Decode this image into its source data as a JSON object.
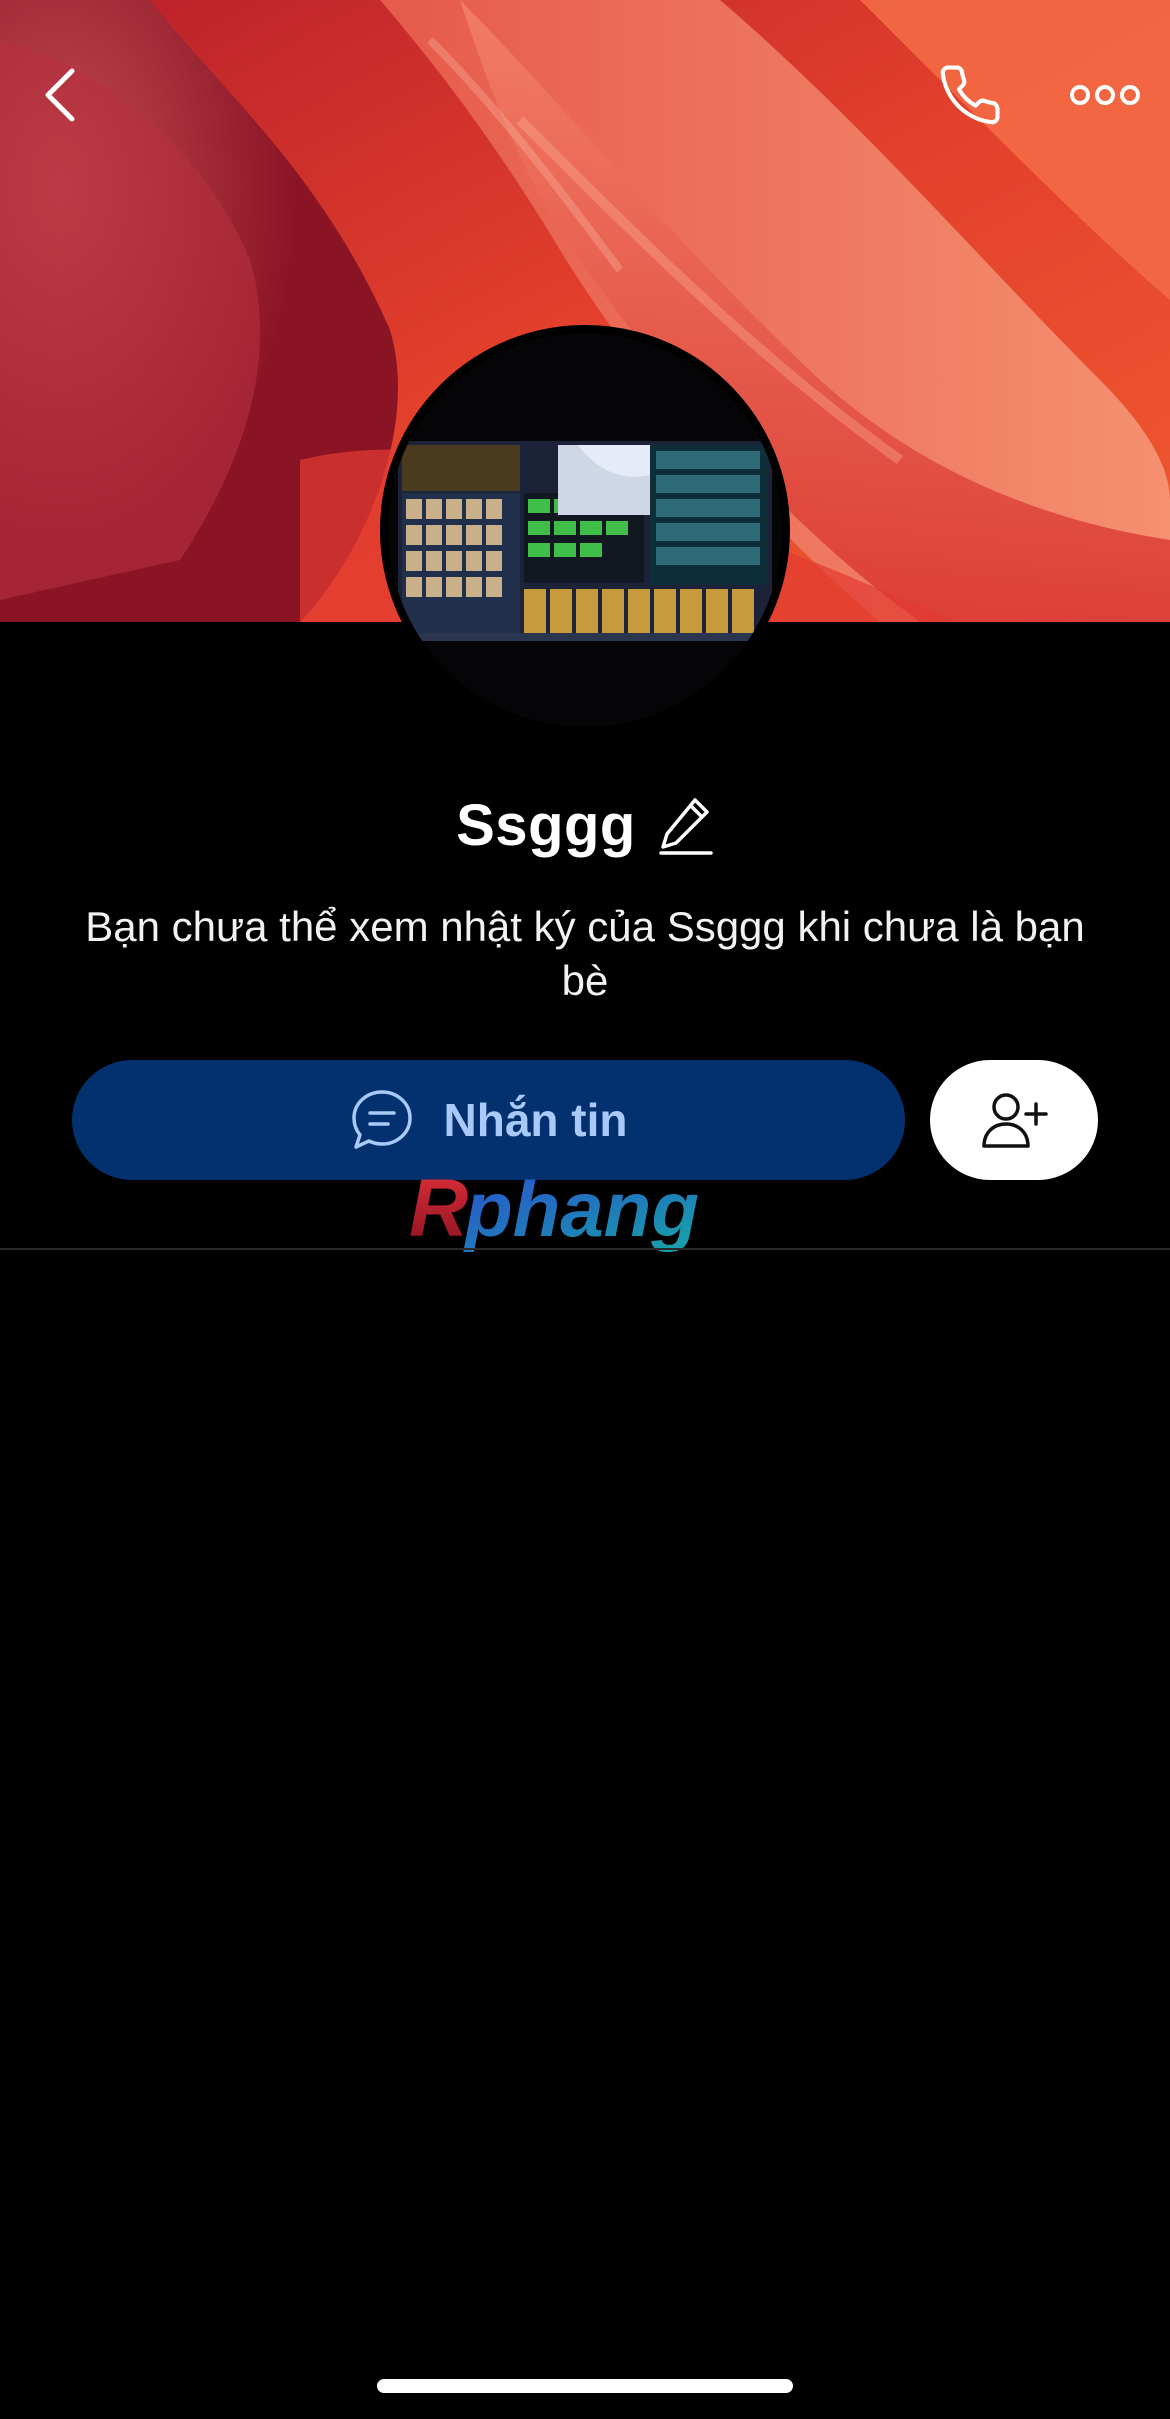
{
  "header": {
    "back_icon": "chevron-left-icon",
    "call_icon": "phone-icon",
    "more_icon": "more-horizontal-icon"
  },
  "cover": {
    "description_colors": [
      "#e43a2a",
      "#f07a55",
      "#a81826"
    ]
  },
  "profile": {
    "name": "Ssggg",
    "edit_icon": "pencil-icon",
    "notice": "Bạn chưa thể xem nhật ký của Ssggg khi chưa là bạn bè"
  },
  "actions": {
    "message_label": "Nhắn tin",
    "message_icon": "chat-bubble-icon",
    "add_friend_icon": "add-user-icon"
  },
  "watermark": {
    "text": "Rphang"
  },
  "colors": {
    "background": "#000000",
    "message_button": "#03306e",
    "message_text": "#a9c9f8",
    "add_friend_button": "#ffffff"
  }
}
